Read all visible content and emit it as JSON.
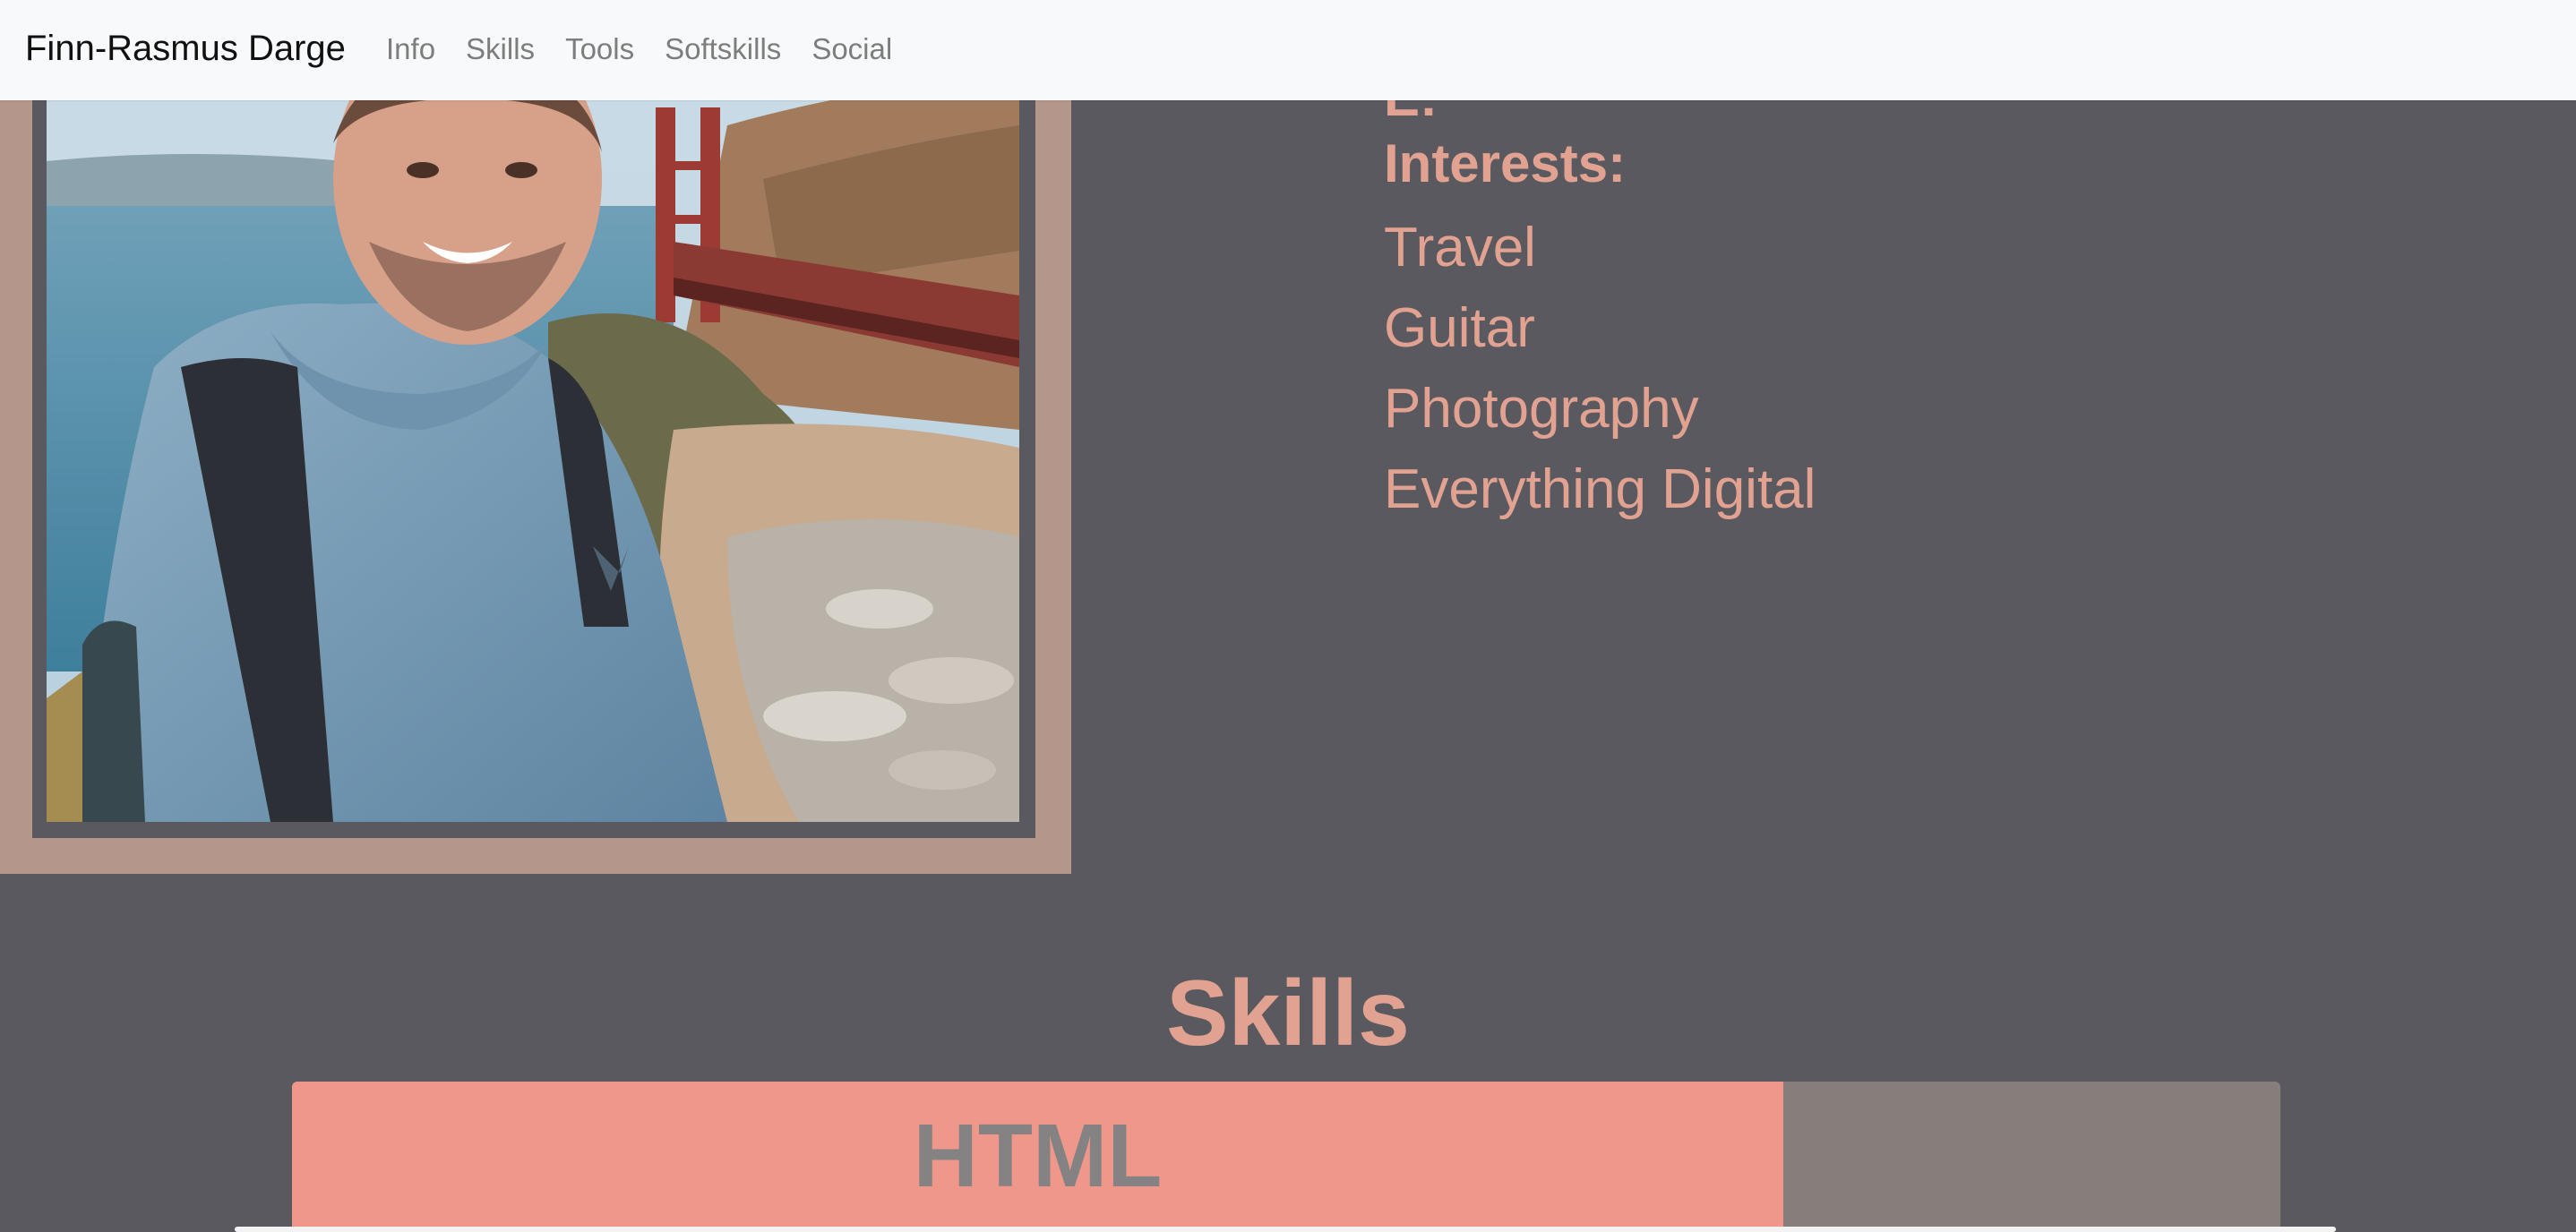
{
  "navbar": {
    "brand": "Finn-Rasmus Darge",
    "links": [
      "Info",
      "Skills",
      "Tools",
      "Softskills",
      "Social"
    ]
  },
  "profile": {
    "partial_text_above": "E:"
  },
  "interests": {
    "heading": "Interests:",
    "items": [
      "Travel",
      "Guitar",
      "Photography",
      "Everything Digital"
    ]
  },
  "skills": {
    "title": "Skills",
    "items": [
      {
        "label": "HTML",
        "percent": 75
      }
    ]
  },
  "colors": {
    "background": "#5a595f",
    "accent": "#e2a291",
    "frame": "#b4968a",
    "bar_fill": "#ef978a",
    "bar_track": "#877d7a",
    "navbar": "#f8f9fa"
  }
}
